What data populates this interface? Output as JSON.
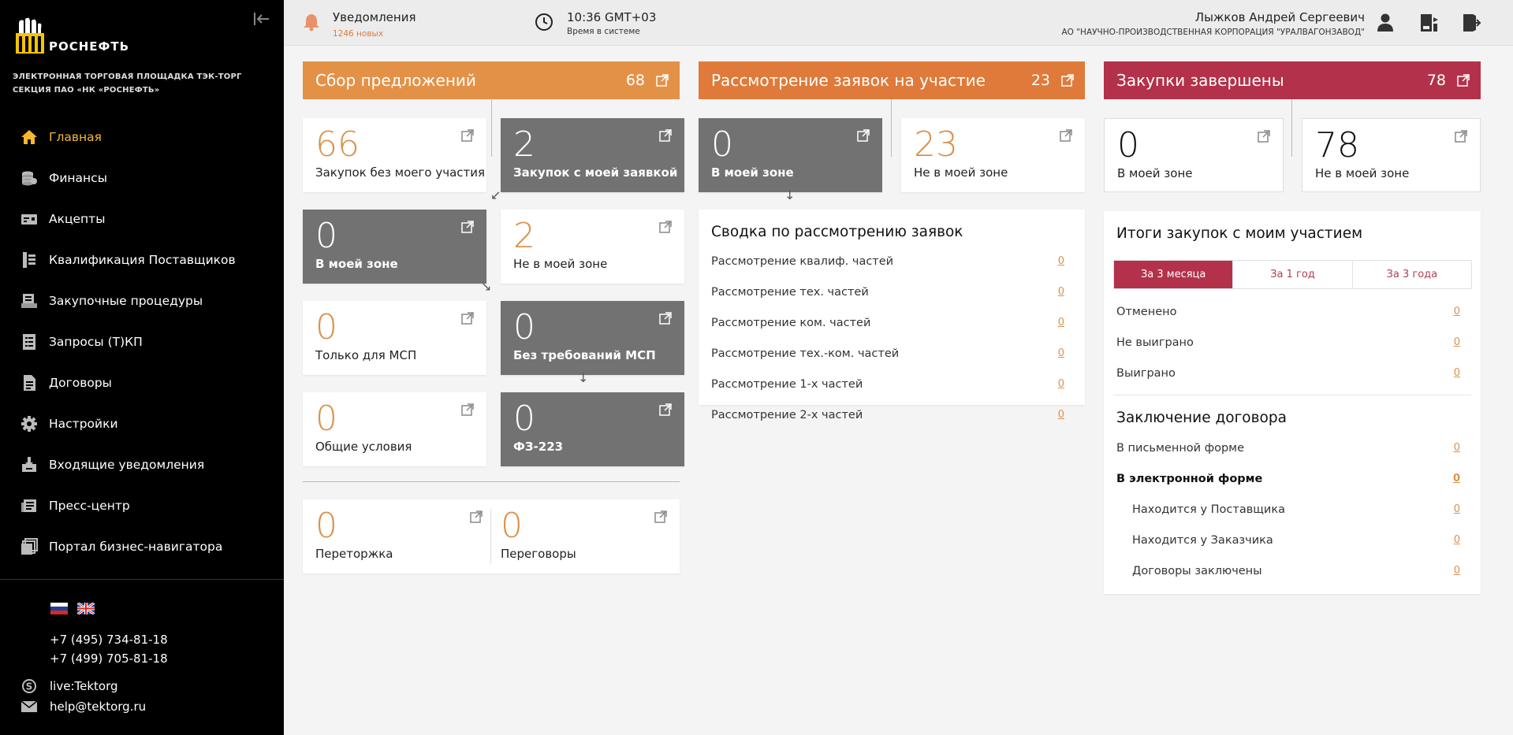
{
  "sidebar": {
    "logo_text": "РОСНЕФТЬ",
    "tagline_1": "ЭЛЕКТРОННАЯ ТОРГОВАЯ ПЛОЩАДКА ТЭК-ТОРГ",
    "tagline_2": "СЕКЦИЯ ПАО «НК «РОСНЕФТЬ»",
    "items": [
      {
        "label": "Главная",
        "icon": "home-icon"
      },
      {
        "label": "Финансы",
        "icon": "coins-icon"
      },
      {
        "label": "Акцепты",
        "icon": "card-icon"
      },
      {
        "label": "Квалификация Поставщиков",
        "icon": "qualification-icon"
      },
      {
        "label": "Закупочные процедуры",
        "icon": "procedures-icon"
      },
      {
        "label": "Запросы (Т)КП",
        "icon": "requests-icon"
      },
      {
        "label": "Договоры",
        "icon": "contracts-icon"
      },
      {
        "label": "Настройки",
        "icon": "gear-icon"
      },
      {
        "label": "Входящие уведомления",
        "icon": "inbox-icon"
      },
      {
        "label": "Пресс-центр",
        "icon": "press-icon"
      },
      {
        "label": "Портал бизнес-навигатора",
        "icon": "portal-icon"
      }
    ],
    "phone_1": "+7 (495) 734-81-18",
    "phone_2": "+7 (499) 705-81-18",
    "skype": "live:Tektorg",
    "email": "help@tektorg.ru"
  },
  "header": {
    "notif_title": "Уведомления",
    "notif_count": "1246 новых",
    "time": "10:36 GMT+03",
    "time_label": "Время в системе",
    "user_name": "Лыжков Андрей Сергеевич",
    "user_org": "АО \"НАУЧНО-ПРОИЗВОДСТВЕННАЯ КОРПОРАЦИЯ \"УРАЛВАГОНЗАВОД\""
  },
  "col1": {
    "title": "Сбор предложений",
    "count": "68",
    "color": "#e49148",
    "cards": [
      {
        "num": "66",
        "label": "Закупок без моего участия"
      },
      {
        "num": "2",
        "label": "Закупок с моей заявкой"
      },
      {
        "num": "0",
        "label": "В моей зоне"
      },
      {
        "num": "2",
        "label": "Не в моей зоне"
      },
      {
        "num": "0",
        "label": "Только для МСП"
      },
      {
        "num": "0",
        "label": "Без требований МСП"
      },
      {
        "num": "0",
        "label": "Общие условия"
      },
      {
        "num": "0",
        "label": "ФЗ-223"
      },
      {
        "num": "0",
        "label": "Переторжка"
      },
      {
        "num": "0",
        "label": "Переговоры"
      }
    ]
  },
  "col2": {
    "title": "Рассмотрение заявок на участие",
    "count": "23",
    "color": "#e07a3a",
    "cards": [
      {
        "num": "0",
        "label": "В моей зоне"
      },
      {
        "num": "23",
        "label": "Не в моей зоне"
      }
    ],
    "summary_title": "Сводка по рассмотрению заявок",
    "rows": [
      {
        "label": "Рассмотрение квалиф. частей",
        "value": "0"
      },
      {
        "label": "Рассмотрение тех. частей",
        "value": "0"
      },
      {
        "label": "Рассмотрение ком. частей",
        "value": "0"
      },
      {
        "label": "Рассмотрение тех.-ком. частей",
        "value": "0"
      },
      {
        "label": "Рассмотрение 1-х частей",
        "value": "0"
      },
      {
        "label": "Рассмотрение 2-х частей",
        "value": "0"
      }
    ]
  },
  "col3": {
    "title": "Закупки завершены",
    "count": "78",
    "color": "#b3314a",
    "cards": [
      {
        "num": "0",
        "label": "В моей зоне"
      },
      {
        "num": "78",
        "label": "Не в моей зоне"
      }
    ],
    "results_title": "Итоги закупок с моим участием",
    "tabs": [
      "За 3 месяца",
      "За 1 год",
      "За 3 года"
    ],
    "result_rows": [
      {
        "label": "Отменено",
        "value": "0"
      },
      {
        "label": "Не выиграно",
        "value": "0"
      },
      {
        "label": "Выиграно",
        "value": "0"
      }
    ],
    "contract_title": "Заключение договора",
    "contract_rows": [
      {
        "label": "В письменной форме",
        "value": "0"
      },
      {
        "label": "В электронной форме",
        "value": "0"
      },
      {
        "label": "Находится у Поставщика",
        "value": "0"
      },
      {
        "label": "Находится у Заказчика",
        "value": "0"
      },
      {
        "label": "Договоры заключены",
        "value": "0"
      }
    ]
  }
}
